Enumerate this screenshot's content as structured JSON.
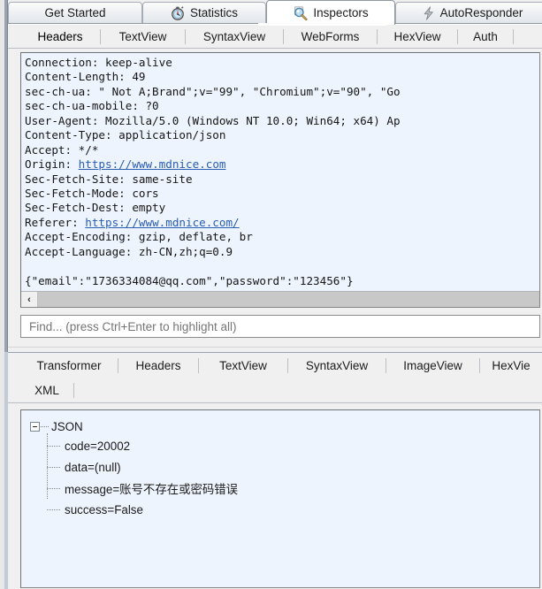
{
  "main_tabs": [
    {
      "label": "Get Started",
      "icon": "none",
      "active": false
    },
    {
      "label": "Statistics",
      "icon": "stopwatch-icon",
      "active": false
    },
    {
      "label": "Inspectors",
      "icon": "magnifier-icon",
      "active": true
    },
    {
      "label": "AutoResponder",
      "icon": "bolt-icon",
      "active": false
    }
  ],
  "request": {
    "sub_tabs": [
      {
        "label": "Headers",
        "active": true
      },
      {
        "label": "TextView",
        "active": false
      },
      {
        "label": "SyntaxView",
        "active": false
      },
      {
        "label": "WebForms",
        "active": false
      },
      {
        "label": "HexView",
        "active": false
      },
      {
        "label": "Auth",
        "active": false
      }
    ],
    "headers": [
      {
        "text": "Connection: keep-alive"
      },
      {
        "text": "Content-Length: 49"
      },
      {
        "text": "sec-ch-ua: \" Not A;Brand\";v=\"99\", \"Chromium\";v=\"90\", \"Go"
      },
      {
        "text": "sec-ch-ua-mobile: ?0"
      },
      {
        "text": "User-Agent: Mozilla/5.0 (Windows NT 10.0; Win64; x64) Ap"
      },
      {
        "text": "Content-Type: application/json"
      },
      {
        "text": "Accept: */*"
      },
      {
        "prefix": "Origin: ",
        "link": "https://www.mdnice.com"
      },
      {
        "text": "Sec-Fetch-Site: same-site"
      },
      {
        "text": "Sec-Fetch-Mode: cors"
      },
      {
        "text": "Sec-Fetch-Dest: empty"
      },
      {
        "prefix": "Referer: ",
        "link": "https://www.mdnice.com/"
      },
      {
        "text": "Accept-Encoding: gzip, deflate, br"
      },
      {
        "text": "Accept-Language: zh-CN,zh;q=0.9"
      },
      {
        "text": ""
      },
      {
        "text": "{\"email\":\"1736334084@qq.com\",\"password\":\"123456\"}"
      }
    ],
    "scroll_left_arrow": "‹"
  },
  "find": {
    "placeholder": "Find... (press Ctrl+Enter to highlight all)",
    "value": ""
  },
  "response": {
    "sub_tabs_row1": [
      {
        "label": "Transformer",
        "active": false
      },
      {
        "label": "Headers",
        "active": false
      },
      {
        "label": "TextView",
        "active": false
      },
      {
        "label": "SyntaxView",
        "active": false
      },
      {
        "label": "ImageView",
        "active": false
      },
      {
        "label": "HexVie",
        "active": false
      }
    ],
    "sub_tabs_row2": [
      {
        "label": "XML",
        "active": false
      }
    ],
    "tree": {
      "root": "JSON",
      "nodes": [
        {
          "label": "code=20002"
        },
        {
          "label": "data=(null)"
        },
        {
          "label": "message=账号不存在或密码错误"
        },
        {
          "label": "success=False"
        }
      ]
    }
  },
  "colors": {
    "panel_bg": "#edf4fd",
    "link": "#2a5db0",
    "chrome": "#f0f0f0",
    "border": "#848484"
  }
}
